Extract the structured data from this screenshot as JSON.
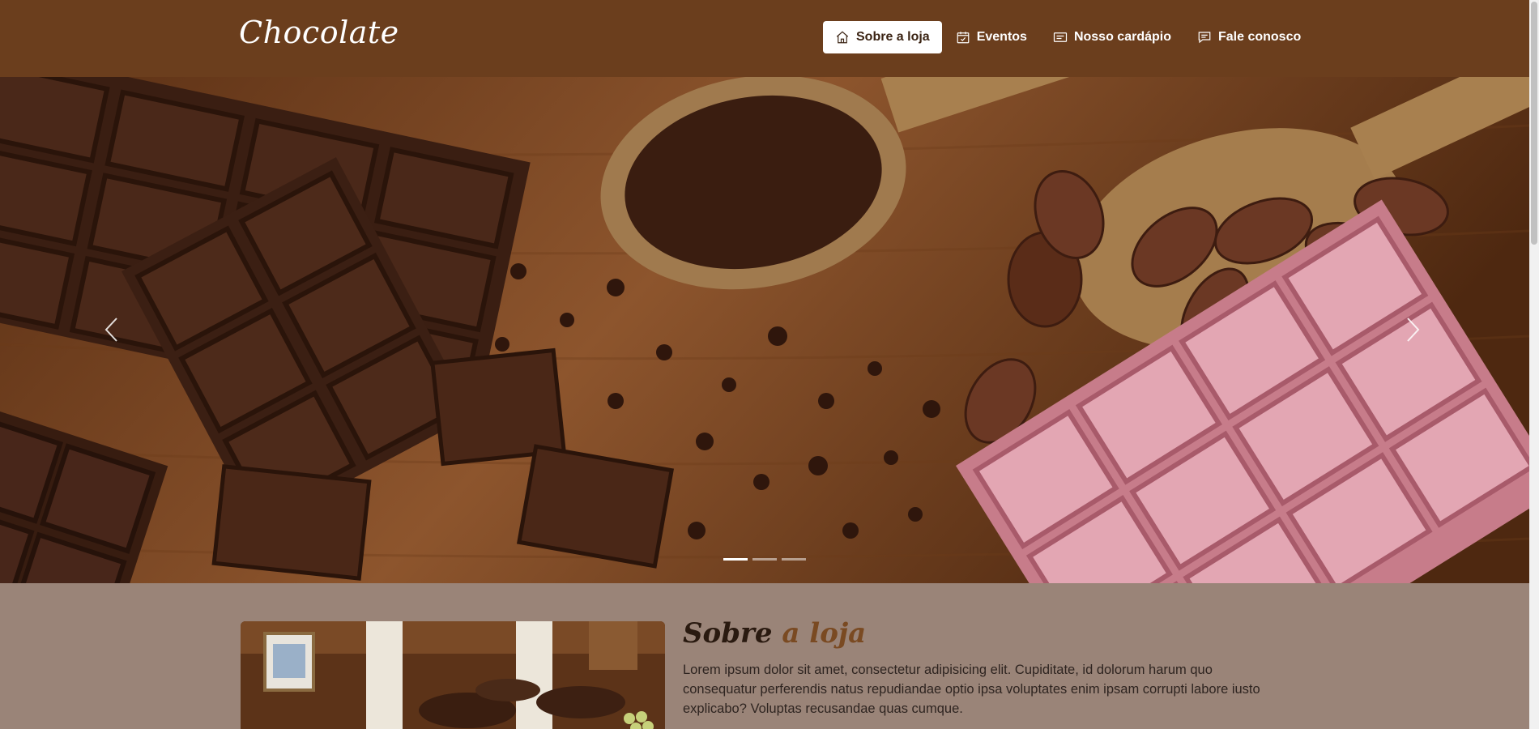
{
  "header": {
    "logo": "Chocolate",
    "nav": [
      {
        "label": "Sobre a loja",
        "icon": "home-icon",
        "active": true
      },
      {
        "label": "Eventos",
        "icon": "calendar-check-icon",
        "active": false
      },
      {
        "label": "Nosso cardápio",
        "icon": "menu-card-icon",
        "active": false
      },
      {
        "label": "Fale conosco",
        "icon": "chat-icon",
        "active": false
      }
    ]
  },
  "carousel": {
    "slides": 3,
    "active_slide": 1
  },
  "about": {
    "title_main": "Sobre",
    "title_accent": "a loja",
    "text": "Lorem ipsum dolor sit amet, consectetur adipisicing elit. Cupiditate, id dolorum harum quo consequatur perferendis natus repudiandae optio ipsa voluptates enim ipsam corrupti labore iusto explicabo? Voluptas recusandae quas cumque."
  },
  "colors": {
    "header_bg": "#6b3e1d",
    "section_bg": "#9a8478",
    "active_nav_bg": "#ffffff"
  }
}
